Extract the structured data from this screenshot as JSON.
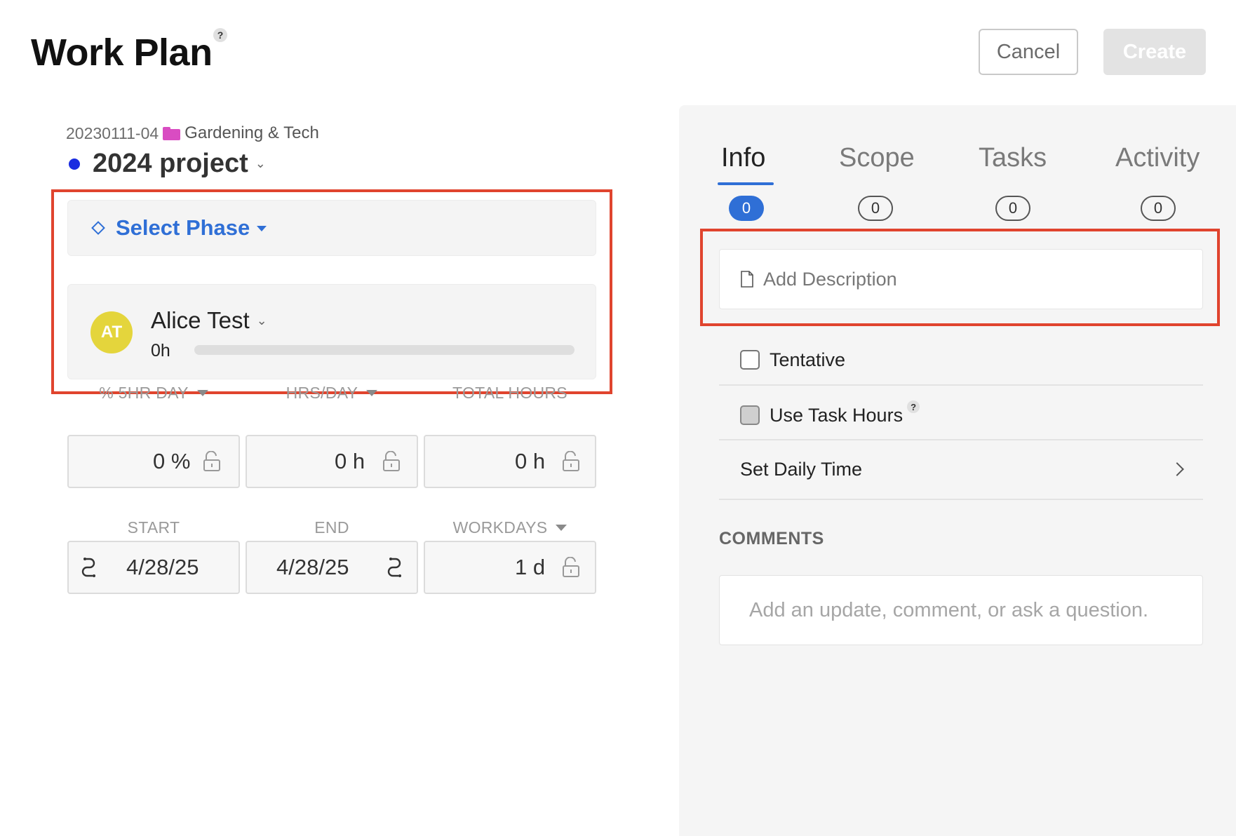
{
  "header": {
    "title": "Work Plan",
    "help": "?",
    "cancel_label": "Cancel",
    "create_label": "Create"
  },
  "project": {
    "code": "20230111-04",
    "folder": "Gardening & Tech",
    "name": "2024 project",
    "dot_color": "#1a2ce0"
  },
  "phase": {
    "label": "Select Phase"
  },
  "member": {
    "initials": "AT",
    "name": "Alice Test",
    "hours": "0h",
    "progress": 0,
    "avatar_color": "#e4d53c"
  },
  "fields": {
    "pct_label": "% 5HR DAY",
    "pct_value": "0 %",
    "hrs_label": "HRS/DAY",
    "hrs_value": "0 h",
    "total_label": "TOTAL HOURS",
    "total_value": "0 h",
    "start_label": "START",
    "start_value": "4/28/25",
    "end_label": "END",
    "end_value": "4/28/25",
    "workdays_label": "WORKDAYS",
    "workdays_value": "1 d"
  },
  "tabs": [
    {
      "label": "Info",
      "count": "0",
      "active": true
    },
    {
      "label": "Scope",
      "count": "0",
      "active": false
    },
    {
      "label": "Tasks",
      "count": "0",
      "active": false
    },
    {
      "label": "Activity",
      "count": "0",
      "active": false
    }
  ],
  "info": {
    "description_placeholder": "Add Description",
    "tentative_label": "Tentative",
    "use_task_hours_label": "Use Task Hours",
    "help": "?",
    "set_daily_time_label": "Set Daily Time",
    "comments_heading": "COMMENTS",
    "comment_placeholder": "Add an update, comment, or ask a question."
  },
  "colors": {
    "accent": "#2f6fd6",
    "highlight": "#e0442e",
    "folder": "#d94cc2"
  }
}
